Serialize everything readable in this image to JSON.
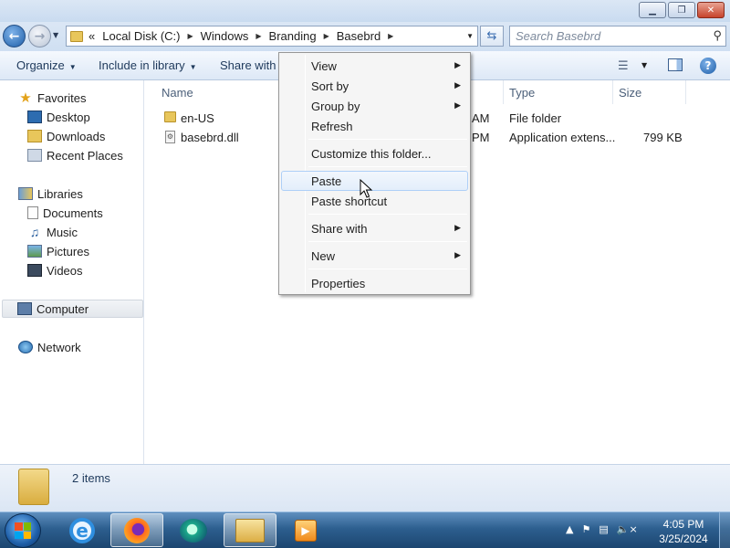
{
  "window": {
    "minimize_glyph": "▁",
    "maximize_glyph": "❐",
    "close_glyph": "✕"
  },
  "address": {
    "prefix": "«",
    "breadcrumbs": [
      "Local Disk (C:)",
      "Windows",
      "Branding",
      "Basebrd"
    ],
    "search_placeholder": "Search Basebrd"
  },
  "toolbar": {
    "organize": "Organize",
    "include_in_library": "Include in library",
    "share_with": "Share with"
  },
  "nav": {
    "favorites": "Favorites",
    "desktop": "Desktop",
    "downloads": "Downloads",
    "recent_places": "Recent Places",
    "libraries": "Libraries",
    "documents": "Documents",
    "music": "Music",
    "pictures": "Pictures",
    "videos": "Videos",
    "computer": "Computer",
    "network": "Network"
  },
  "columns": {
    "name": "Name",
    "type": "Type",
    "size": "Size"
  },
  "files": [
    {
      "name": "en-US",
      "date_fragment": "AM",
      "type": "File folder",
      "size": ""
    },
    {
      "name": "basebrd.dll",
      "date_fragment": "PM",
      "type": "Application extens...",
      "size": "799 KB"
    }
  ],
  "status": {
    "item_count": "2 items"
  },
  "context_menu": {
    "view": "View",
    "sort_by": "Sort by",
    "group_by": "Group by",
    "refresh": "Refresh",
    "customize": "Customize this folder...",
    "paste": "Paste",
    "paste_shortcut": "Paste shortcut",
    "share_with": "Share with",
    "new": "New",
    "properties": "Properties",
    "hovered": "Paste"
  },
  "taskbar": {
    "time": "4:05 PM",
    "date": "3/25/2024"
  },
  "colors": {
    "accent": "#1e5ea8",
    "menu_hover": "#e3eefb",
    "taskbar": "#2d5f8f"
  }
}
